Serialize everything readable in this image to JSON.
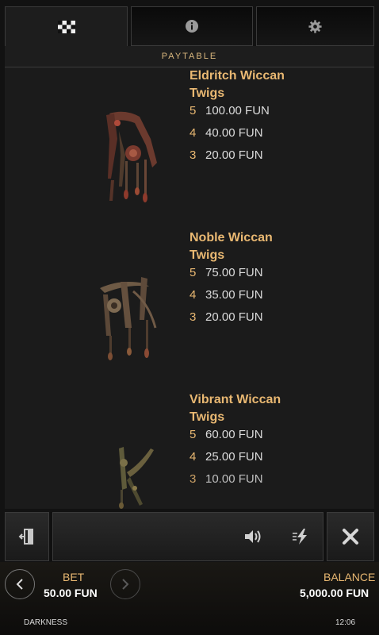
{
  "tabs": [
    {
      "name": "paytable",
      "icon": "checkerboard-icon",
      "active": true
    },
    {
      "name": "info",
      "icon": "info-icon",
      "active": false
    },
    {
      "name": "settings",
      "icon": "gear-icon",
      "active": false
    }
  ],
  "paytable_title": "PAYTABLE",
  "symbols": [
    {
      "name_line1": "Eldritch Wiccan",
      "name_line2": "Twigs",
      "payouts": [
        {
          "count": "5",
          "amount": "100.00 FUN"
        },
        {
          "count": "4",
          "amount": "40.00 FUN"
        },
        {
          "count": "3",
          "amount": "20.00 FUN"
        }
      ]
    },
    {
      "name_line1": "Noble Wiccan",
      "name_line2": "Twigs",
      "payouts": [
        {
          "count": "5",
          "amount": "75.00 FUN"
        },
        {
          "count": "4",
          "amount": "35.00 FUN"
        },
        {
          "count": "3",
          "amount": "20.00 FUN"
        }
      ]
    },
    {
      "name_line1": "Vibrant Wiccan",
      "name_line2": "Twigs",
      "payouts": [
        {
          "count": "5",
          "amount": "60.00 FUN"
        },
        {
          "count": "4",
          "amount": "25.00 FUN"
        },
        {
          "count": "3",
          "amount": "10.00 FUN"
        }
      ]
    }
  ],
  "controls": {
    "exit_icon": "exit-door-icon",
    "sound_icon": "speaker-icon",
    "turbo_icon": "lightning-icon",
    "close_icon": "close-icon"
  },
  "footer": {
    "bet_label": "BET",
    "bet_value": "50.00 FUN",
    "balance_label": "BALANCE",
    "balance_value": "5,000.00 FUN",
    "game_name": "DARKNESS",
    "clock": "12:06"
  },
  "colors": {
    "accent_gold": "#e9b872",
    "panel_bg": "#1b1b1b"
  }
}
